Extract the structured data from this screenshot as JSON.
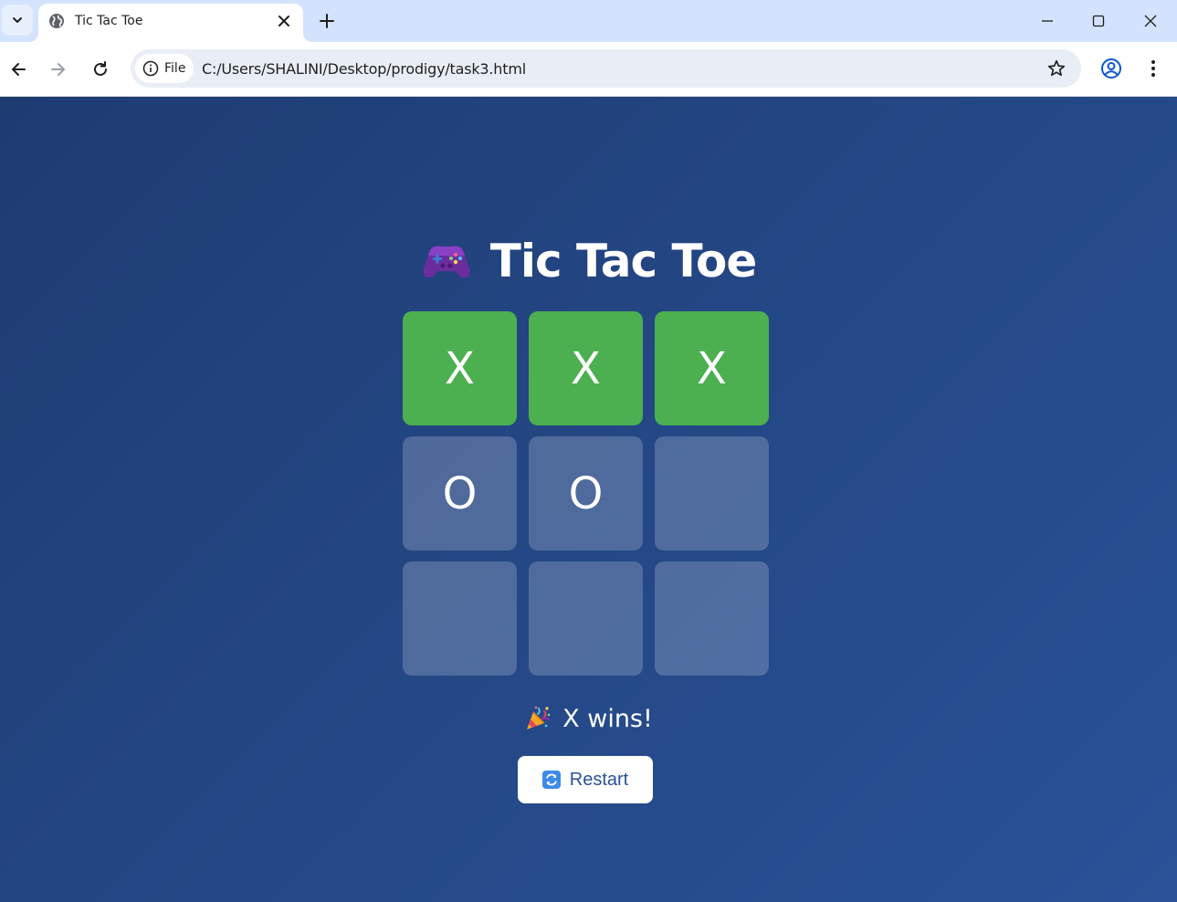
{
  "browser": {
    "tab_title": "Tic Tac Toe",
    "chip_label": "File",
    "url": "C:/Users/SHALINI/Desktop/prodigy/task3.html",
    "icons": [
      "tab-search-icon",
      "globe-icon",
      "close-icon",
      "plus-icon",
      "minimize-icon",
      "maximize-icon",
      "window-close-icon",
      "back-arrow-icon",
      "forward-arrow-icon",
      "reload-icon",
      "info-icon",
      "star-icon",
      "profile-icon",
      "more-vert-icon"
    ]
  },
  "game": {
    "title": "Tic Tac Toe",
    "title_icon": "game-controller-icon",
    "board": [
      {
        "value": "X",
        "win": true
      },
      {
        "value": "X",
        "win": true
      },
      {
        "value": "X",
        "win": true
      },
      {
        "value": "O",
        "win": false
      },
      {
        "value": "O",
        "win": false
      },
      {
        "value": "",
        "win": false
      },
      {
        "value": "",
        "win": false
      },
      {
        "value": "",
        "win": false
      },
      {
        "value": "",
        "win": false
      }
    ],
    "status": "X wins!",
    "status_icon": "party-popper-icon",
    "restart_label": "Restart",
    "restart_icon": "refresh-icon",
    "colors": {
      "background_start": "#1e3c72",
      "background_end": "#2a5298",
      "win_cell": "#4caf50",
      "cell": "rgba(255,255,255,0.2)",
      "button_text": "#2a5298"
    }
  }
}
